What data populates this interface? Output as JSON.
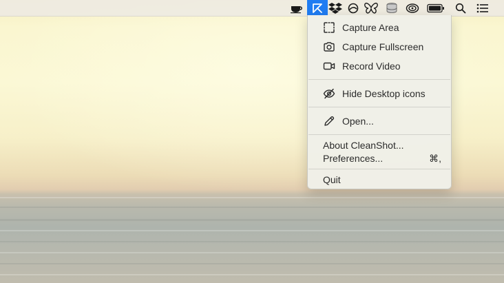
{
  "menubar": {
    "icons": [
      {
        "name": "coffee-cup-icon"
      },
      {
        "name": "cleanshot-icon",
        "active": true
      },
      {
        "name": "dropbox-icon"
      },
      {
        "name": "circle-slash-icon"
      },
      {
        "name": "butterfly-icon"
      },
      {
        "name": "database-icon"
      },
      {
        "name": "swirl-icon"
      },
      {
        "name": "battery-icon"
      },
      {
        "name": "search-icon"
      },
      {
        "name": "list-icon"
      }
    ],
    "active_color": "#1f7cf2"
  },
  "menu": {
    "capture_area": "Capture Area",
    "capture_fullscreen": "Capture Fullscreen",
    "record_video": "Record Video",
    "hide_desktop_icons": "Hide Desktop icons",
    "open": "Open...",
    "about": "About CleanShot...",
    "preferences": "Preferences...",
    "preferences_shortcut": "⌘,",
    "quit": "Quit"
  }
}
